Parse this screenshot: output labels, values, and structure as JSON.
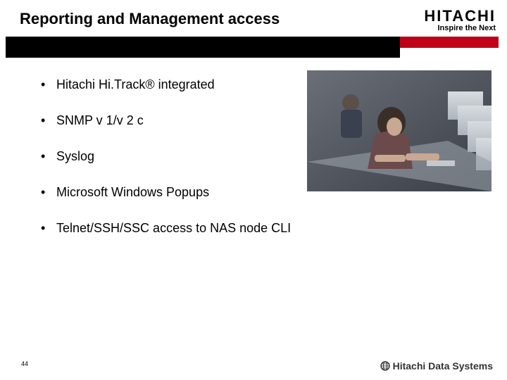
{
  "header": {
    "title": "Reporting and Management access",
    "brand": "HITACHI",
    "tagline": "Inspire the Next"
  },
  "bullets": [
    "Hitachi Hi.Track® integrated",
    "SNMP v 1/v 2 c",
    "Syslog",
    "Microsoft Windows Popups",
    "Telnet/SSH/SSC access to NAS node CLI"
  ],
  "footer": {
    "slide_number": "44",
    "brand": "Hitachi Data Systems"
  }
}
